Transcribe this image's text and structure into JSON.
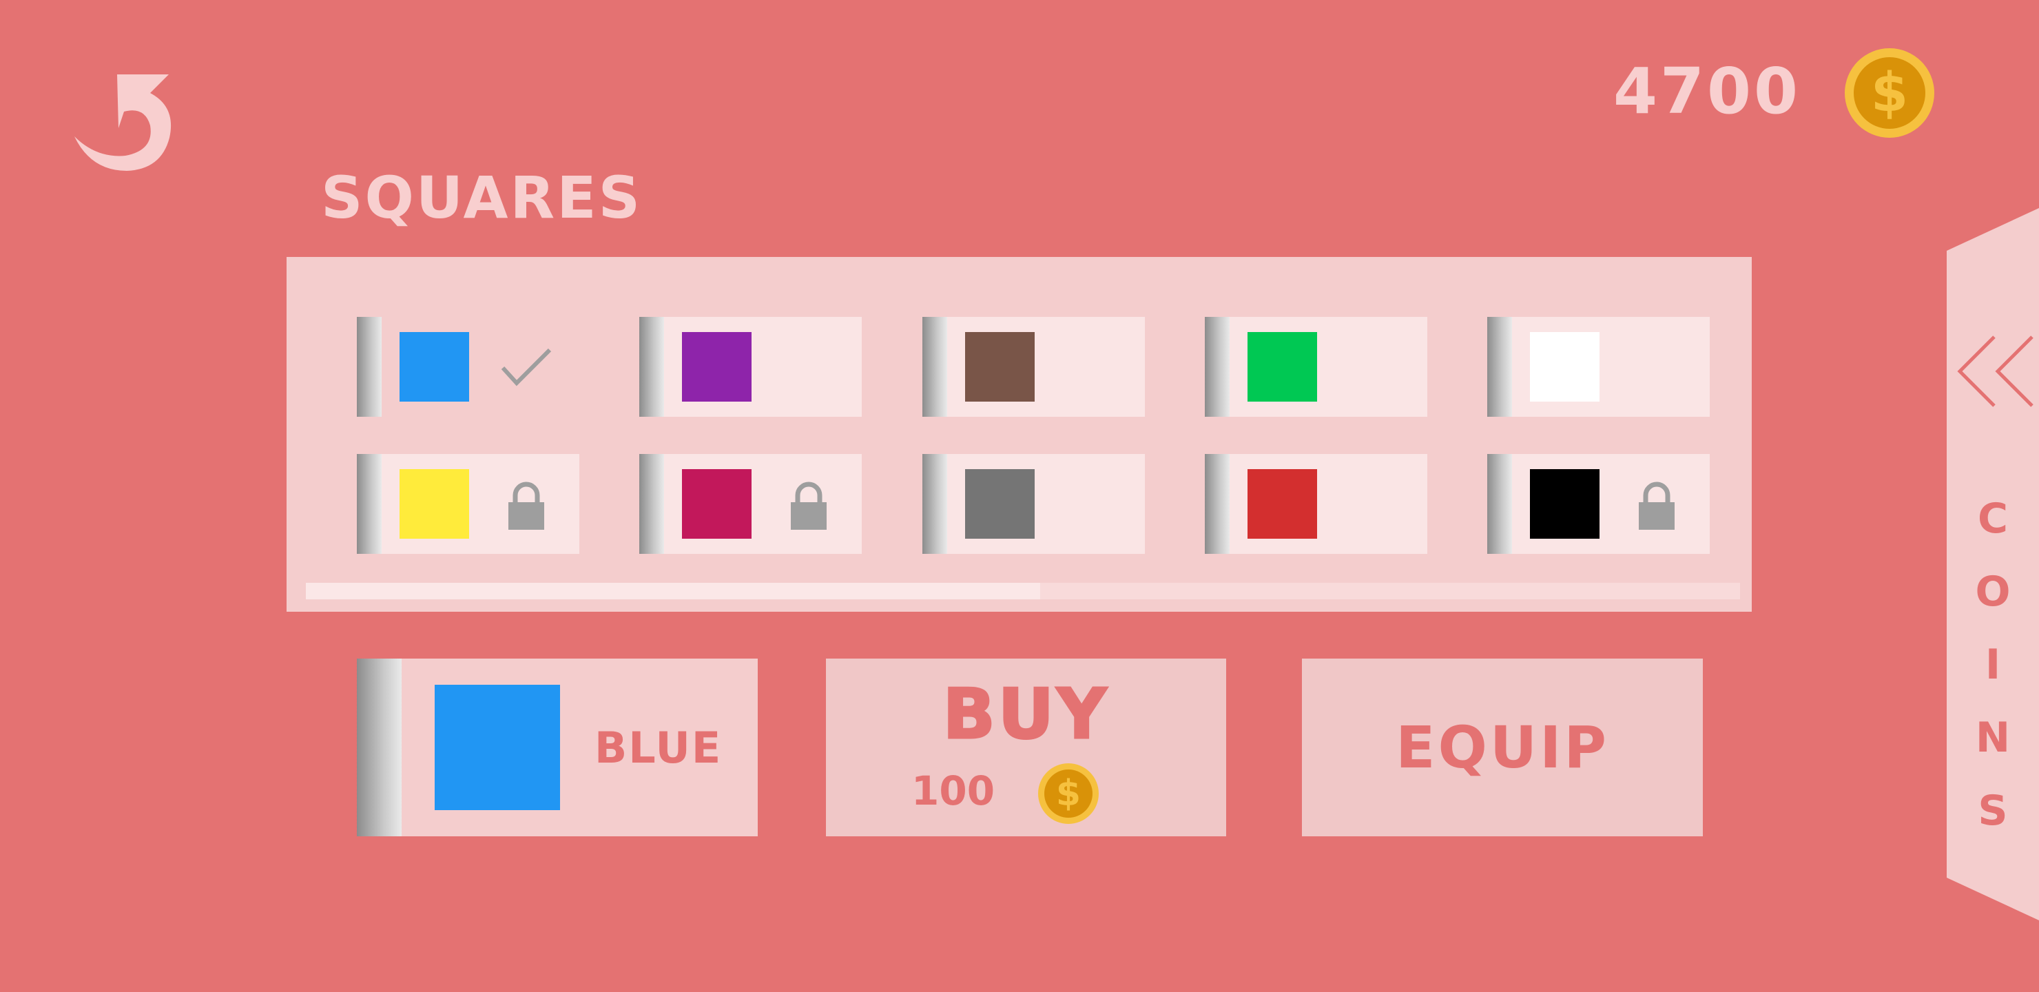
{
  "header": {
    "back_icon": "back-arrow-icon",
    "coin_balance": "4700",
    "coin_symbol": "$"
  },
  "category_title": "SQUARES",
  "items": [
    {
      "color_name": "blue",
      "color": "#2196F3",
      "status": "equipped",
      "status_icon": "check-icon"
    },
    {
      "color_name": "purple",
      "color": "#8E24AA",
      "status": "owned"
    },
    {
      "color_name": "brown",
      "color": "#795548",
      "status": "owned"
    },
    {
      "color_name": "green",
      "color": "#00C853",
      "status": "owned"
    },
    {
      "color_name": "white",
      "color": "#FFFFFF",
      "status": "owned"
    },
    {
      "color_name": "yellow",
      "color": "#FFEB3B",
      "status": "locked",
      "status_icon": "lock-icon"
    },
    {
      "color_name": "magenta",
      "color": "#C2185B",
      "status": "locked",
      "status_icon": "lock-icon"
    },
    {
      "color_name": "gray",
      "color": "#757575",
      "status": "owned"
    },
    {
      "color_name": "red",
      "color": "#D32F2F",
      "status": "owned"
    },
    {
      "color_name": "black",
      "color": "#000000",
      "status": "locked",
      "status_icon": "lock-icon"
    }
  ],
  "scrollbar": {
    "position_fraction": 0.0,
    "visible_fraction": 0.51
  },
  "selected_item": {
    "name": "BLUE",
    "color": "#2196F3"
  },
  "buy": {
    "label": "BUY",
    "price": "100",
    "coin_symbol": "$"
  },
  "equip": {
    "label": "EQUIP"
  },
  "side_tab": {
    "label": [
      "C",
      "O",
      "I",
      "N",
      "S"
    ],
    "icon": "double-chevron-left-icon"
  },
  "colors": {
    "background": "#E47272",
    "panel": "#F4CDCD",
    "item": "#FAE5E5",
    "coin_outer": "#F6C13F",
    "coin_inner": "#D99208",
    "accent_text": "#F8CFCF"
  }
}
